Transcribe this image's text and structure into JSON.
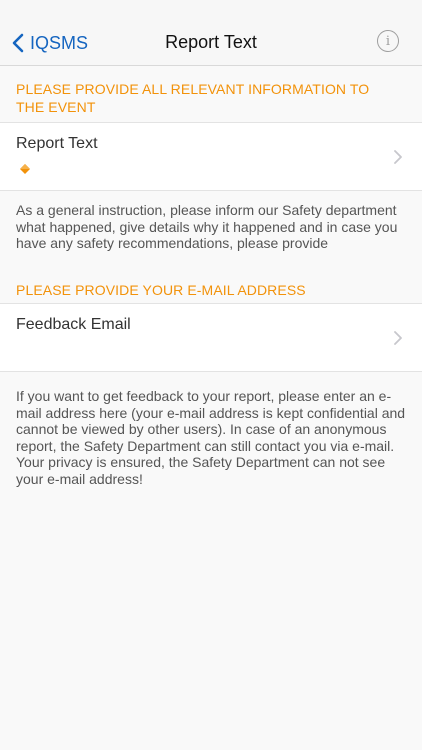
{
  "nav": {
    "back_label": "IQSMS",
    "title": "Report Text",
    "info_glyph": "i"
  },
  "sections": [
    {
      "header": "PLEASE PROVIDE ALL RELEVANT INFORMATION TO THE EVENT",
      "cell_label": "Report Text",
      "footer": "As a general instruction, please inform our Safety department what happened, give details why it happened and in case you have any safety recommendations, please provide"
    },
    {
      "header": "PLEASE PROVIDE YOUR E-MAIL ADDRESS",
      "cell_label": "Feedback Email",
      "footer": "If you want to get feedback to your report, please enter an e-mail address here (your e-mail address is kept confidential and cannot be viewed by other users). In case of an anonymous report, the Safety Department can still contact you via e-mail. Your privacy is ensured, the Safety Department can not see your e-mail address!"
    }
  ],
  "colors": {
    "accent": "#f2920a",
    "link": "#1565c0",
    "background": "#f9f9f9"
  }
}
